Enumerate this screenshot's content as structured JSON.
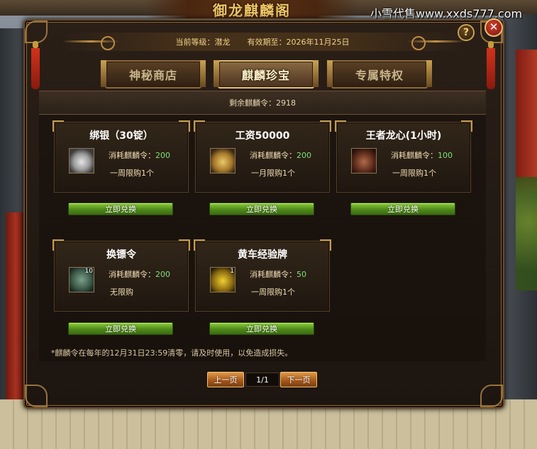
{
  "title_banner": "御龙麒麟阁",
  "watermark": "小雪代售www.xxds777.com",
  "help_label": "?",
  "close_label": "✕",
  "header": {
    "level": "当前等级：潜龙",
    "expiry": "有效期至：2026年11月25日"
  },
  "tabs": [
    {
      "label": "神秘商店",
      "active": false
    },
    {
      "label": "麒麟珍宝",
      "active": true
    },
    {
      "label": "专属特权",
      "active": false
    }
  ],
  "remaining": "剩余麒麟令：2918",
  "cost_label": "消耗麒麟令：",
  "items": [
    {
      "name": "绑银（30锭）",
      "icon": "silver-ingot-icon",
      "cost": "200",
      "limit": "一周限购1个",
      "qty": ""
    },
    {
      "name": "工资50000",
      "icon": "money-bag-icon",
      "cost": "200",
      "limit": "一月限购1个",
      "qty": ""
    },
    {
      "name": "王者龙心(1小时)",
      "icon": "dragon-heart-icon",
      "cost": "100",
      "limit": "一周限购1个",
      "qty": ""
    },
    {
      "name": "换镖令",
      "icon": "escort-token-icon",
      "cost": "200",
      "limit": "无限购",
      "qty": "10"
    },
    {
      "name": "黄车经验牌",
      "icon": "yellow-cart-icon",
      "cost": "50",
      "limit": "一周限购1个",
      "qty": "1"
    }
  ],
  "redeem_label": "立即兑换",
  "note": "*麒麟令在每年的12月31日23:59清零，请及时使用，以免造成损失。",
  "pager": {
    "prev": "上一页",
    "page": "1/1",
    "next": "下一页"
  }
}
